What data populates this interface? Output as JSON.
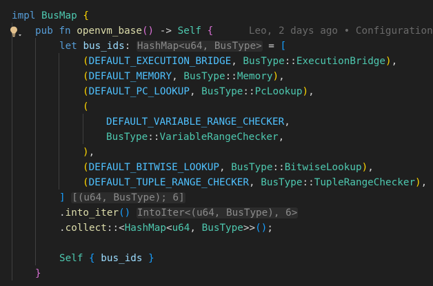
{
  "lines": [
    [
      {
        "t": "impl",
        "c": "kw"
      },
      {
        "t": " "
      },
      {
        "t": "BusMap",
        "c": "ty"
      },
      {
        "t": " "
      },
      {
        "t": "{",
        "c": "p1"
      }
    ],
    [
      {
        "t": "pub",
        "c": "kw"
      },
      {
        "t": " "
      },
      {
        "t": "fn",
        "c": "kw"
      },
      {
        "t": " "
      },
      {
        "t": "openvm_base",
        "c": "fn"
      },
      {
        "t": "()",
        "c": "p2"
      },
      {
        "t": " -> ",
        "c": "op"
      },
      {
        "t": "Self",
        "c": "ty"
      },
      {
        "t": " "
      },
      {
        "t": "{",
        "c": "p2"
      },
      {
        "t": "      "
      },
      {
        "t": "Leo, 2 days ago • Configuration",
        "c": "blame"
      }
    ],
    [
      {
        "t": "let",
        "c": "kw"
      },
      {
        "t": " "
      },
      {
        "t": "bus_ids",
        "c": "var"
      },
      {
        "t": ": ",
        "c": "op"
      },
      {
        "t": "HashMap<u64, BusType>",
        "c": "hint"
      },
      {
        "t": " = ",
        "c": "op"
      },
      {
        "t": "[",
        "c": "p3"
      }
    ],
    [
      {
        "t": "(",
        "c": "p1"
      },
      {
        "t": "DEFAULT_EXECUTION_BRIDGE",
        "c": "con"
      },
      {
        "t": ", ",
        "c": "op"
      },
      {
        "t": "BusType",
        "c": "ty"
      },
      {
        "t": "::",
        "c": "op"
      },
      {
        "t": "ExecutionBridge",
        "c": "ty"
      },
      {
        "t": ")",
        "c": "p1"
      },
      {
        "t": ",",
        "c": "op"
      }
    ],
    [
      {
        "t": "(",
        "c": "p1"
      },
      {
        "t": "DEFAULT_MEMORY",
        "c": "con"
      },
      {
        "t": ", ",
        "c": "op"
      },
      {
        "t": "BusType",
        "c": "ty"
      },
      {
        "t": "::",
        "c": "op"
      },
      {
        "t": "Memory",
        "c": "ty"
      },
      {
        "t": ")",
        "c": "p1"
      },
      {
        "t": ",",
        "c": "op"
      }
    ],
    [
      {
        "t": "(",
        "c": "p1"
      },
      {
        "t": "DEFAULT_PC_LOOKUP",
        "c": "con"
      },
      {
        "t": ", ",
        "c": "op"
      },
      {
        "t": "BusType",
        "c": "ty"
      },
      {
        "t": "::",
        "c": "op"
      },
      {
        "t": "PcLookup",
        "c": "ty"
      },
      {
        "t": ")",
        "c": "p1"
      },
      {
        "t": ",",
        "c": "op"
      }
    ],
    [
      {
        "t": "(",
        "c": "p1"
      }
    ],
    [
      {
        "t": "DEFAULT_VARIABLE_RANGE_CHECKER",
        "c": "con"
      },
      {
        "t": ",",
        "c": "op"
      }
    ],
    [
      {
        "t": "BusType",
        "c": "ty"
      },
      {
        "t": "::",
        "c": "op"
      },
      {
        "t": "VariableRangeChecker",
        "c": "ty"
      },
      {
        "t": ",",
        "c": "op"
      }
    ],
    [
      {
        "t": ")",
        "c": "p1"
      },
      {
        "t": ",",
        "c": "op"
      }
    ],
    [
      {
        "t": "(",
        "c": "p1"
      },
      {
        "t": "DEFAULT_BITWISE_LOOKUP",
        "c": "con"
      },
      {
        "t": ", ",
        "c": "op"
      },
      {
        "t": "BusType",
        "c": "ty"
      },
      {
        "t": "::",
        "c": "op"
      },
      {
        "t": "BitwiseLookup",
        "c": "ty"
      },
      {
        "t": ")",
        "c": "p1"
      },
      {
        "t": ",",
        "c": "op"
      }
    ],
    [
      {
        "t": "(",
        "c": "p1"
      },
      {
        "t": "DEFAULT_TUPLE_RANGE_CHECKER",
        "c": "con"
      },
      {
        "t": ", ",
        "c": "op"
      },
      {
        "t": "BusType",
        "c": "ty"
      },
      {
        "t": "::",
        "c": "op"
      },
      {
        "t": "TupleRangeChecker",
        "c": "ty"
      },
      {
        "t": ")",
        "c": "p1"
      },
      {
        "t": ",",
        "c": "op"
      }
    ],
    [
      {
        "t": "]",
        "c": "p3"
      },
      {
        "t": " "
      },
      {
        "t": "[(u64, BusType); 6]",
        "c": "hint"
      }
    ],
    [
      {
        "t": ".",
        "c": "op"
      },
      {
        "t": "into_iter",
        "c": "fn"
      },
      {
        "t": "()",
        "c": "p3"
      },
      {
        "t": " "
      },
      {
        "t": "IntoIter<(u64, BusType), 6>",
        "c": "hint"
      }
    ],
    [
      {
        "t": ".",
        "c": "op"
      },
      {
        "t": "collect",
        "c": "fn"
      },
      {
        "t": "::<",
        "c": "op"
      },
      {
        "t": "HashMap",
        "c": "ty"
      },
      {
        "t": "<",
        "c": "op"
      },
      {
        "t": "u64",
        "c": "ty"
      },
      {
        "t": ", ",
        "c": "op"
      },
      {
        "t": "BusType",
        "c": "ty"
      },
      {
        "t": ">>",
        "c": "op"
      },
      {
        "t": "()",
        "c": "p3"
      },
      {
        "t": ";",
        "c": "op"
      }
    ],
    [],
    [
      {
        "t": "Self",
        "c": "ty"
      },
      {
        "t": " "
      },
      {
        "t": "{",
        "c": "p3"
      },
      {
        "t": " "
      },
      {
        "t": "bus_ids",
        "c": "var"
      },
      {
        "t": " "
      },
      {
        "t": "}",
        "c": "p3"
      }
    ],
    [
      {
        "t": "}",
        "c": "p2"
      }
    ]
  ],
  "colors": {
    "background": "#1f1f1f",
    "keyword": "#569cd6",
    "type": "#4ec9b0",
    "function": "#dcdcaa",
    "variable": "#9cdcfe",
    "constant": "#4fc1ff",
    "bracket_gold": "#ffd700",
    "bracket_orchid": "#da70d6",
    "bracket_blue": "#179fff",
    "inlay_hint": "#8b8b8b",
    "blame": "#6a6a6a",
    "lightbulb": "#e2c08d"
  },
  "icons": {
    "gutter": "lightbulb-icon"
  }
}
